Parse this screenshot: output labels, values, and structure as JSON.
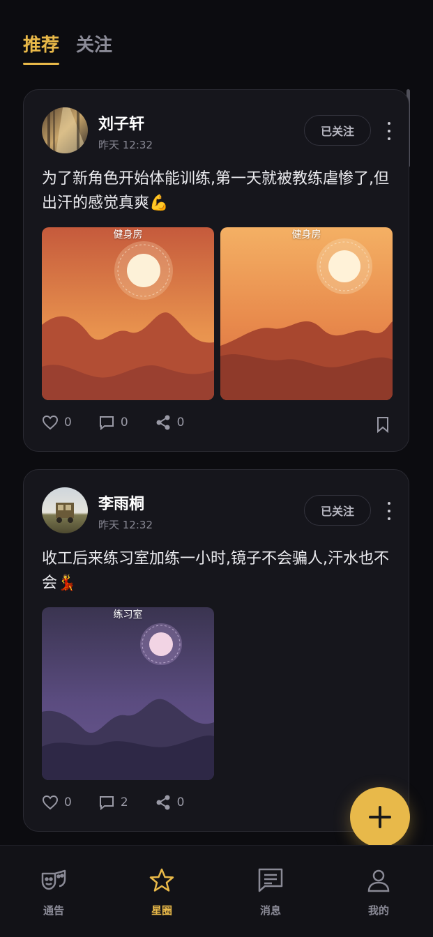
{
  "top_tabs": [
    {
      "label": "推荐",
      "active": true
    },
    {
      "label": "关注",
      "active": false
    }
  ],
  "colors": {
    "accent": "#e9b949",
    "background": "#0c0c10",
    "card": "#16161c"
  },
  "posts": [
    {
      "author": "刘子轩",
      "time": "昨天 12:32",
      "follow_label": "已关注",
      "text": "为了新角色开始体能训练,第一天就被教练虐惨了,但出汗的感觉真爽💪",
      "images": [
        {
          "label": "健身房",
          "theme": "sunset-orange"
        },
        {
          "label": "健身房",
          "theme": "sunset-amber"
        }
      ],
      "likes": "0",
      "comments": "0",
      "shares": "0",
      "has_bookmark": true
    },
    {
      "author": "李雨桐",
      "time": "昨天 12:32",
      "follow_label": "已关注",
      "text": "收工后来练习室加练一小时,镜子不会骗人,汗水也不会💃",
      "images": [
        {
          "label": "练习室",
          "theme": "dusk-purple"
        }
      ],
      "likes": "0",
      "comments": "2",
      "shares": "0",
      "has_bookmark": false
    }
  ],
  "fab": {
    "icon": "plus-icon"
  },
  "bottom_nav": [
    {
      "label": "通告",
      "icon": "theater-mask-icon",
      "active": false
    },
    {
      "label": "星圈",
      "icon": "star-icon",
      "active": true
    },
    {
      "label": "消息",
      "icon": "message-icon",
      "active": false
    },
    {
      "label": "我的",
      "icon": "user-icon",
      "active": false
    }
  ]
}
